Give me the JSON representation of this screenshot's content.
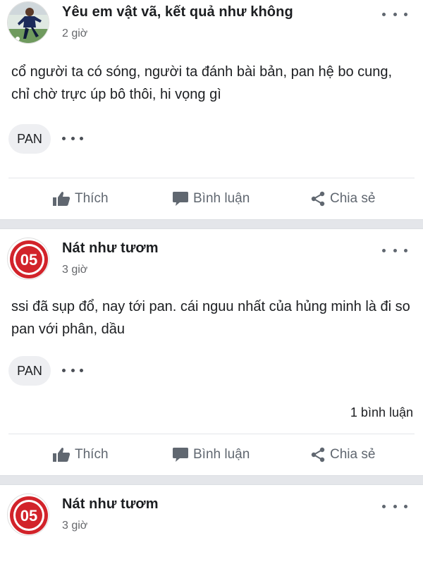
{
  "posts": [
    {
      "author": "Yêu em vật vã, kết quả như không",
      "time": "2 giờ",
      "text": "cổ người ta có sóng, người ta đánh bài bản, pan hệ bo cung, chỉ chờ trực úp bô thôi, hi vọng gì",
      "tag": "PAN",
      "avatar": "player-photo"
    },
    {
      "author": "Nát như tươm",
      "time": "3 giờ",
      "text": "ssi đã sụp đổ, nay tới pan. cái nguu nhất của hủng minh là đi so pan với phân, dầu",
      "tag": "PAN",
      "comments": "1 bình luận",
      "avatar": "mainz-05-logo"
    },
    {
      "author": "Nát như tươm",
      "time": "3 giờ",
      "avatar": "mainz-05-logo"
    }
  ],
  "actions": {
    "like": "Thích",
    "comment": "Bình luận",
    "share": "Chia sẻ"
  },
  "colors": {
    "logo_red": "#d2232a",
    "text_secondary": "#606770",
    "separator": "#e4e6ea"
  },
  "icons": [
    "thumbs-up-icon",
    "comment-bubble-icon",
    "share-icon",
    "more-dots-icon"
  ]
}
